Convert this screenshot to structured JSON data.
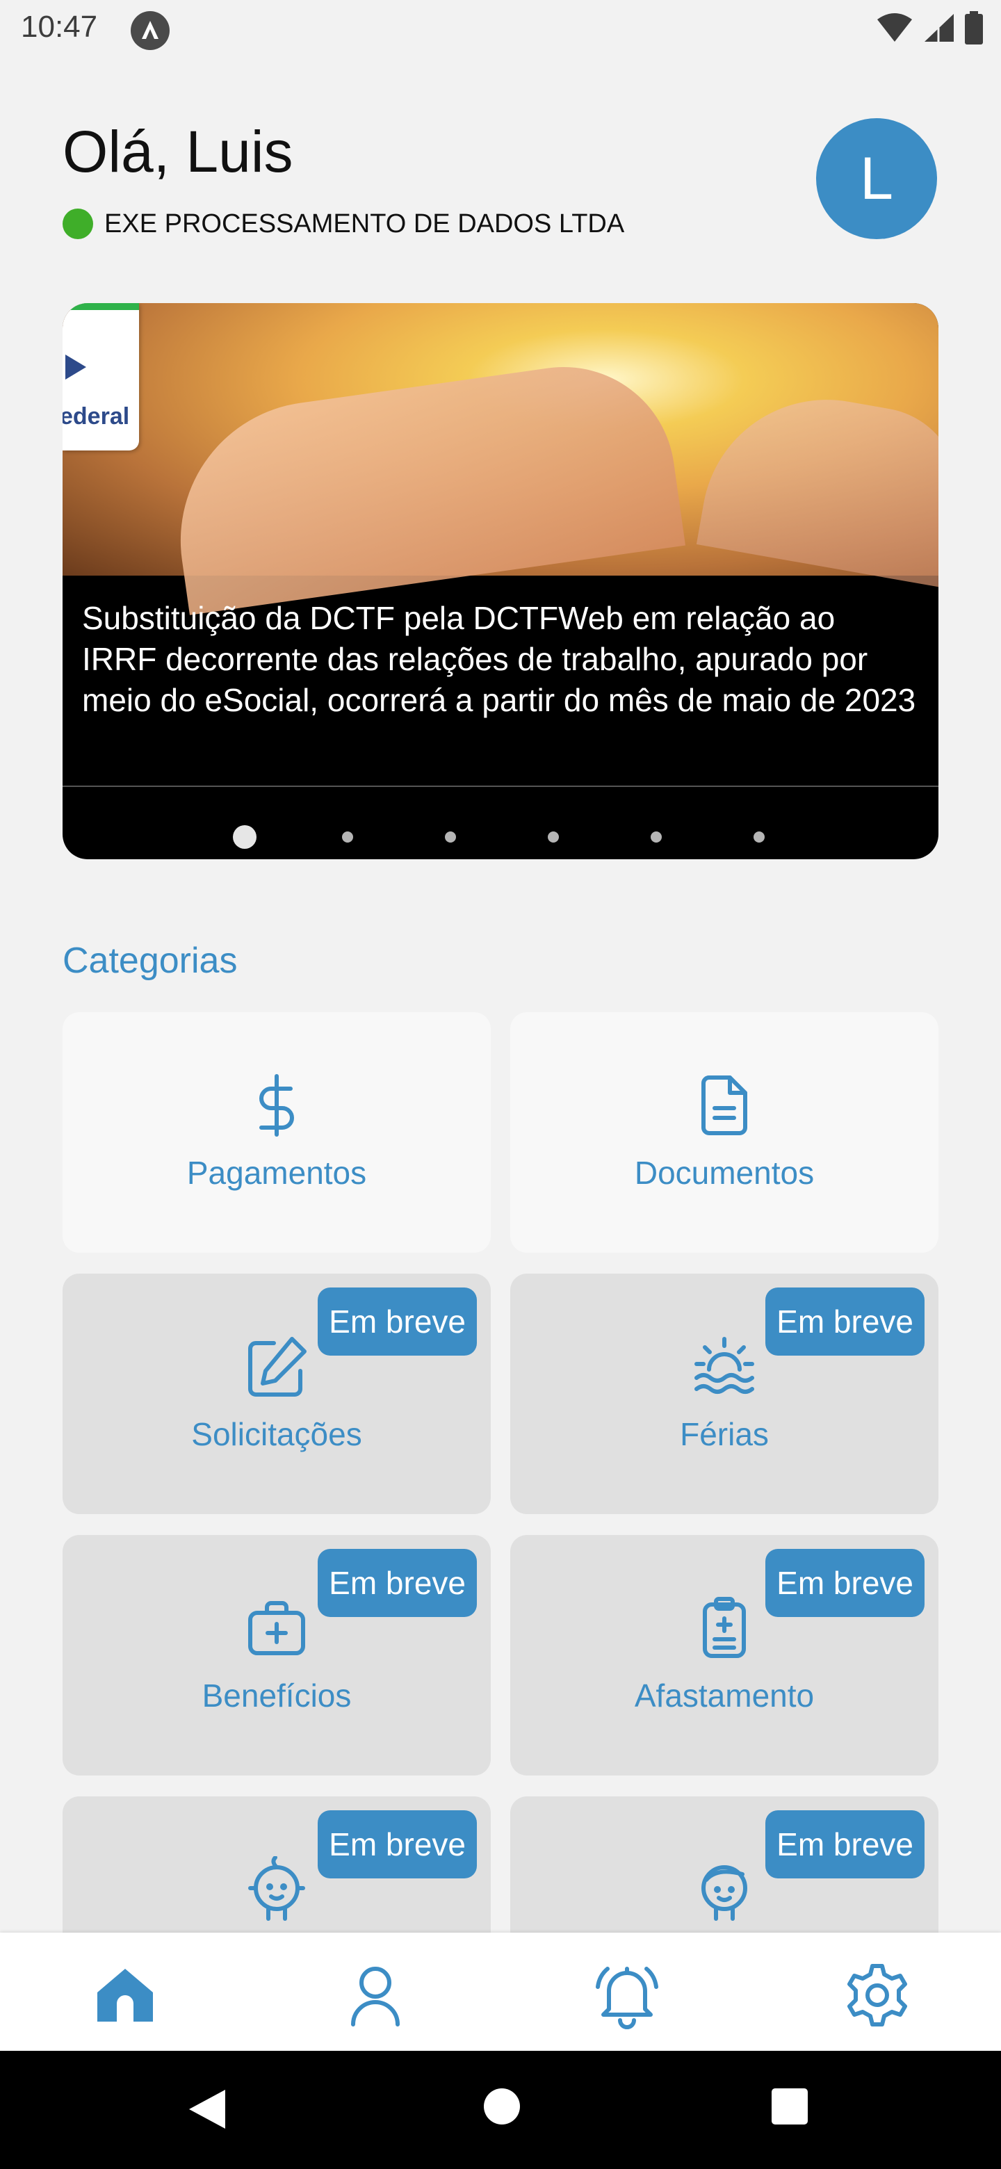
{
  "status_bar": {
    "time": "10:47"
  },
  "header": {
    "greeting": "Olá, Luis",
    "company": "EXE PROCESSAMENTO DE DADOS LTDA",
    "avatar_initial": "L"
  },
  "carousel": {
    "caption": "Substituição da DCTF pela DCTFWeb em relação ao IRRF decorrente das relações de trabalho, apurado por meio do eSocial, ocorrerá a partir do mês de maio de 2023",
    "logo_text": "ederal",
    "slide_count": 6,
    "active_index": 0
  },
  "categories": {
    "title": "Categorias",
    "items": [
      {
        "label": "Pagamentos",
        "icon": "dollar-icon",
        "badge": ""
      },
      {
        "label": "Documentos",
        "icon": "document-icon",
        "badge": ""
      },
      {
        "label": "Solicitações",
        "icon": "edit-icon",
        "badge": "Em breve"
      },
      {
        "label": "Férias",
        "icon": "sunset-icon",
        "badge": "Em breve"
      },
      {
        "label": "Benefícios",
        "icon": "medical-kit-icon",
        "badge": "Em breve"
      },
      {
        "label": "Afastamento",
        "icon": "clipboard-icon",
        "badge": "Em breve"
      },
      {
        "label": "",
        "icon": "baby-icon",
        "badge": "Em breve"
      },
      {
        "label": "",
        "icon": "child-icon",
        "badge": "Em breve"
      }
    ]
  },
  "bottom_nav": {
    "items": [
      {
        "icon": "home-icon",
        "active": true
      },
      {
        "icon": "profile-icon",
        "active": false
      },
      {
        "icon": "bell-icon",
        "active": false
      },
      {
        "icon": "settings-icon",
        "active": false
      }
    ]
  },
  "colors": {
    "accent": "#3c8dc5",
    "status_online": "#3fae29",
    "disabled_card": "#e0e0e0"
  }
}
